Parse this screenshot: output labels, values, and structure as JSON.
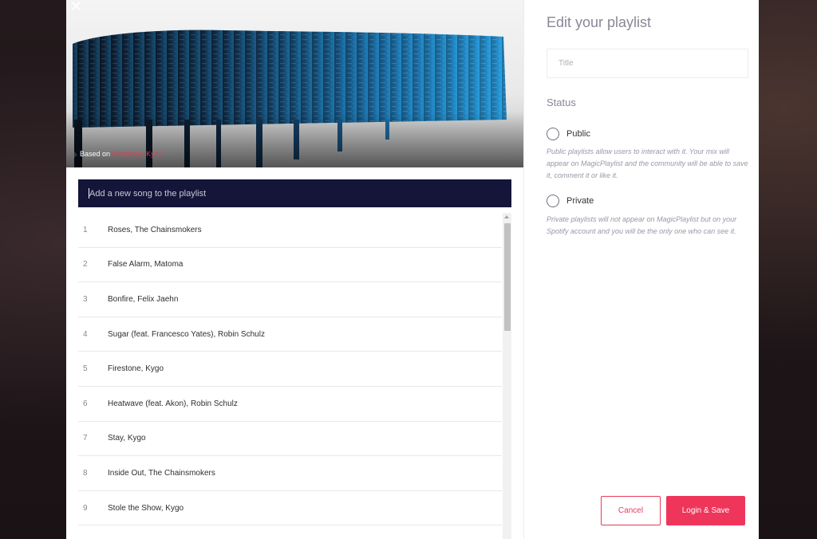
{
  "cover": {
    "close_glyph": "✕",
    "based_on_label": "Based on",
    "based_on_value": "Firestone, Kygo"
  },
  "add_song": {
    "placeholder": "Add a new song to the playlist"
  },
  "songs": [
    {
      "number": "1",
      "title": "Roses, The Chainsmokers"
    },
    {
      "number": "2",
      "title": "False Alarm, Matoma"
    },
    {
      "number": "3",
      "title": "Bonfire, Felix Jaehn"
    },
    {
      "number": "4",
      "title": "Sugar (feat. Francesco Yates), Robin Schulz"
    },
    {
      "number": "5",
      "title": "Firestone, Kygo"
    },
    {
      "number": "6",
      "title": "Heatwave (feat. Akon), Robin Schulz"
    },
    {
      "number": "7",
      "title": "Stay, Kygo"
    },
    {
      "number": "8",
      "title": "Inside Out, The Chainsmokers"
    },
    {
      "number": "9",
      "title": "Stole the Show, Kygo"
    }
  ],
  "edit_panel": {
    "heading": "Edit your playlist",
    "title_placeholder": "Title",
    "status_label": "Status",
    "public_label": "Public",
    "public_description": "Public playlists allow users to interact with it. Your mix will appear on MagicPlaylist and the community will be able to save it, comment it or like it.",
    "private_label": "Private",
    "private_description": "Private playlists will not appear on MagicPlaylist but on your Spotify account and you will be the only one who can see it."
  },
  "actions": {
    "cancel_label": "Cancel",
    "save_label": "Login & Save"
  },
  "colors": {
    "accent": "#f0355b",
    "input_bg": "#141539",
    "muted_heading": "#8a8797"
  }
}
